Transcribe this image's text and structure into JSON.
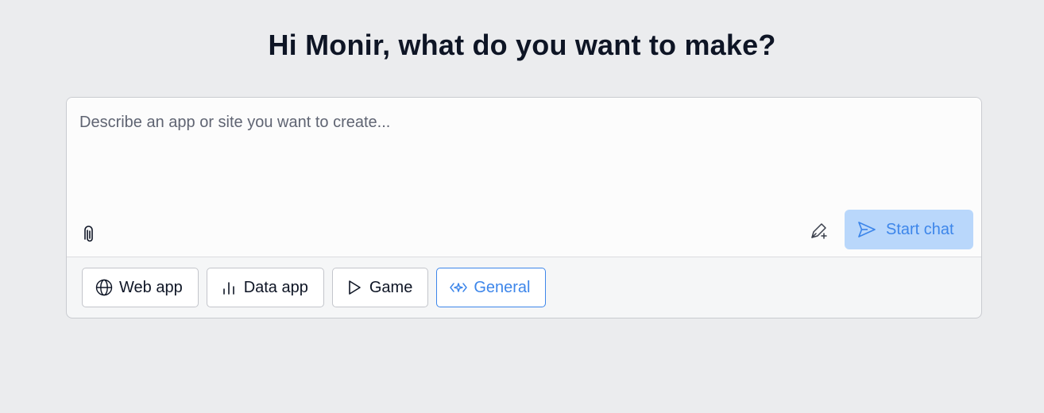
{
  "heading": "Hi Monir, what do you want to make?",
  "composer": {
    "placeholder": "Describe an app or site you want to create...",
    "value": "",
    "attach_icon": "paperclip-icon",
    "pen_icon": "pen-sparkle-icon",
    "start_button": {
      "label": "Start chat",
      "icon": "send-icon"
    }
  },
  "app_types": [
    {
      "label": "Web app",
      "icon": "globe-icon",
      "selected": false
    },
    {
      "label": "Data app",
      "icon": "bar-chart-icon",
      "selected": false
    },
    {
      "label": "Game",
      "icon": "play-icon",
      "selected": false
    },
    {
      "label": "General",
      "icon": "code-sparkle-icon",
      "selected": true
    }
  ],
  "colors": {
    "background": "#ebecee",
    "accent": "#3d86ea",
    "start_button_bg": "#b9d7fb",
    "text": "#0e1525"
  }
}
